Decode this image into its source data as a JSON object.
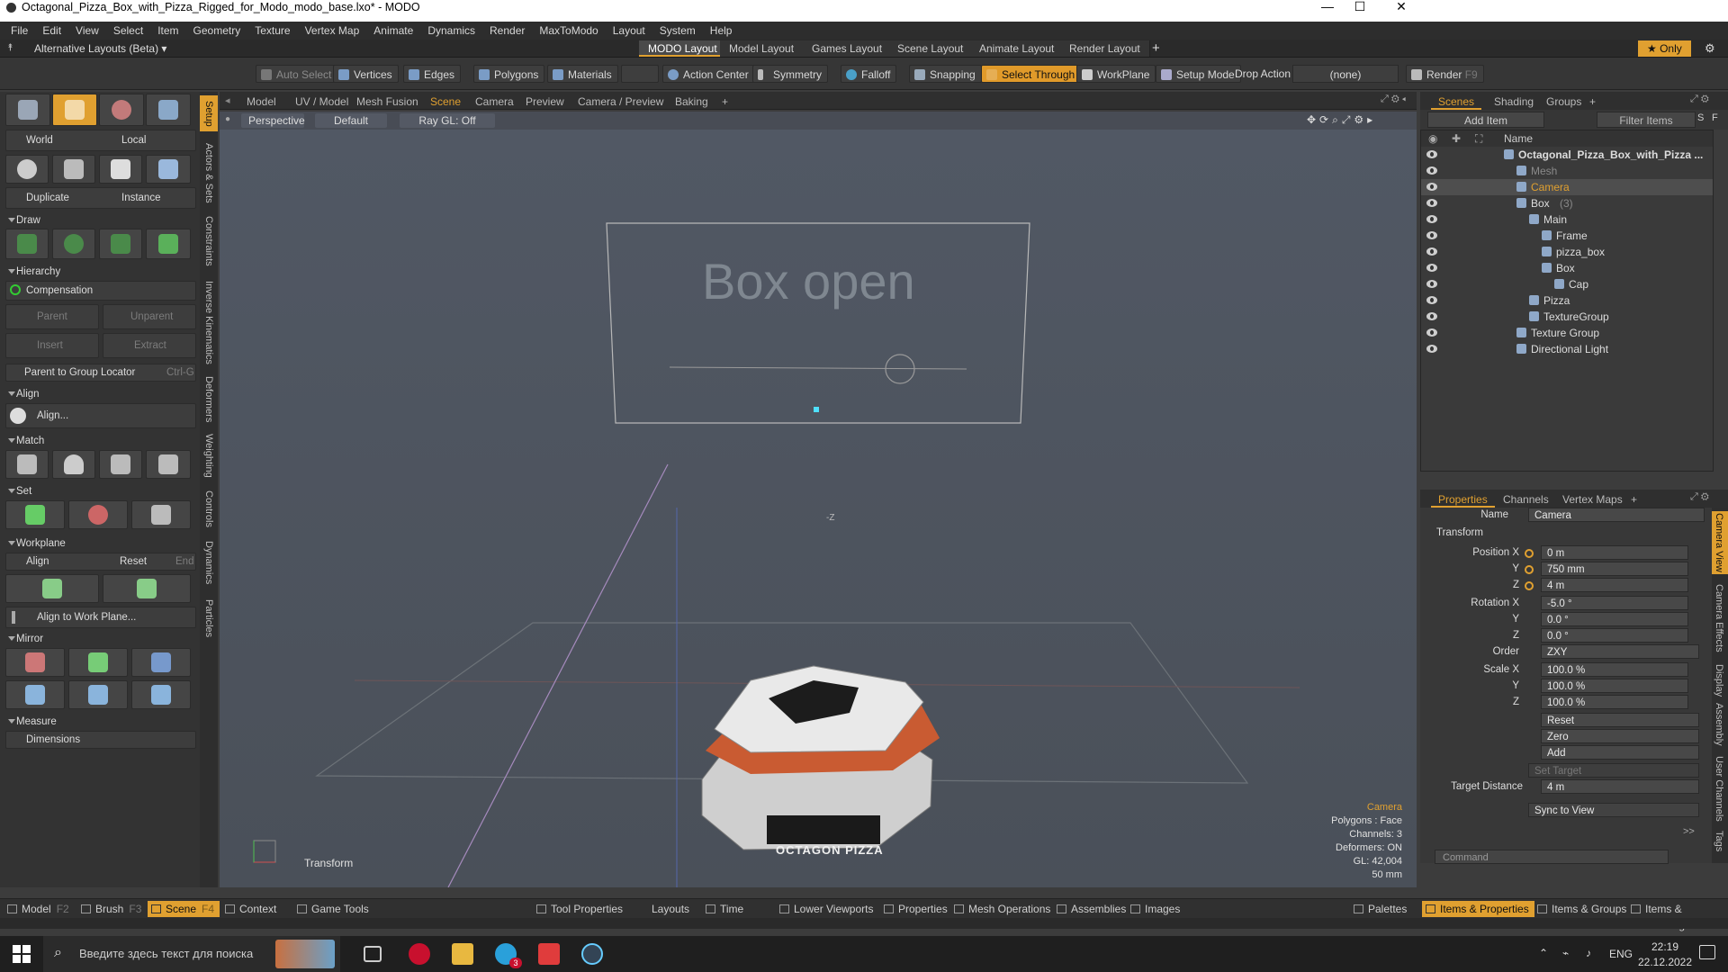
{
  "window": {
    "title": "Octagonal_Pizza_Box_with_Pizza_Rigged_for_Modo_modo_base.lxo* - MODO",
    "minimize": "—",
    "maximize": "☐",
    "close": "✕"
  },
  "menu": [
    "File",
    "Edit",
    "View",
    "Select",
    "Item",
    "Geometry",
    "Texture",
    "Vertex Map",
    "Animate",
    "Dynamics",
    "Render",
    "MaxToModo",
    "Layout",
    "System",
    "Help"
  ],
  "layoutbar": {
    "alt_layouts": "Alternative Layouts (Beta) ▾",
    "tabs": [
      "MODO Layout",
      "Model Layout",
      "Games Layout",
      "Scene Layout",
      "Animate Layout",
      "Render Layout"
    ],
    "plus": "+",
    "only": "★  Only"
  },
  "toolbar": {
    "auto_select": "Auto Select",
    "vertices": "Vertices",
    "edges": "Edges",
    "polygons": "Polygons",
    "materials": "Materials",
    "action_center": "Action Center",
    "symmetry": "Symmetry",
    "falloff": "Falloff",
    "snapping": "Snapping",
    "select_through": "Select Through",
    "workplane": "WorkPlane",
    "setup_mode": "Setup Mode",
    "drop_action": "Drop Action",
    "drop_value": "(none)",
    "render": "Render",
    "render_key": "F9"
  },
  "left": {
    "world": "World",
    "local": "Local",
    "duplicate": "Duplicate",
    "instance": "Instance",
    "draw": "Draw",
    "hierarchy": "Hierarchy",
    "compensation": "Compensation",
    "parent": "Parent",
    "unparent": "Unparent",
    "insert": "Insert",
    "extract": "Extract",
    "parent_group": "Parent to Group Locator",
    "parent_group_key": "Ctrl-G",
    "align": "Align",
    "align_btn": "Align...",
    "match": "Match",
    "set": "Set",
    "workplane": "Workplane",
    "wp_align": "Align",
    "wp_reset": "Reset",
    "wp_end": "End",
    "align_wp": "Align to Work Plane...",
    "mirror": "Mirror",
    "measure": "Measure",
    "dimensions": "Dimensions"
  },
  "vtabs_left": [
    "Setup",
    "Actors & Sets",
    "Constraints",
    "Inverse Kinematics",
    "Deformers",
    "Weighting",
    "Controls",
    "Dynamics",
    "Particles"
  ],
  "viewport": {
    "tabs": [
      "Model",
      "UV / Model",
      "Mesh Fusion",
      "Scene",
      "Camera",
      "Preview",
      "Camera / Preview",
      "Baking"
    ],
    "plus": "+",
    "perspective": "Perspective",
    "default": "Default",
    "raygl": "Ray GL: Off",
    "box_open": "Box open",
    "pizza_label": "OCTAGON PIZZA",
    "axis_z": "-Z",
    "transform": "Transform",
    "info": {
      "camera": "Camera",
      "polygons": "Polygons : Face",
      "channels": "Channels: 3",
      "deformers": "Deformers: ON",
      "gl": "GL: 42,004",
      "mm": "50 mm"
    }
  },
  "scene": {
    "tabs": [
      "Scenes",
      "Shading",
      "Groups"
    ],
    "plus": "+",
    "add_item": "Add Item",
    "filter_items": "Filter Items",
    "s": "S",
    "f": "F",
    "col_name": "Name",
    "items": [
      {
        "label": "Octagonal_Pizza_Box_with_Pizza ...",
        "indent": 0,
        "bold": true
      },
      {
        "label": "Mesh",
        "indent": 1,
        "dim": true
      },
      {
        "label": "Camera",
        "indent": 1,
        "sel": true,
        "orange": true
      },
      {
        "label": "Box",
        "suffix": "(3)",
        "indent": 1
      },
      {
        "label": "Main",
        "indent": 2
      },
      {
        "label": "Frame",
        "indent": 3
      },
      {
        "label": "pizza_box",
        "indent": 3
      },
      {
        "label": "Box",
        "indent": 3
      },
      {
        "label": "Cap",
        "indent": 4
      },
      {
        "label": "Pizza",
        "indent": 2
      },
      {
        "label": "TextureGroup",
        "indent": 2
      },
      {
        "label": "Texture Group",
        "indent": 1
      },
      {
        "label": "Directional Light",
        "indent": 1
      }
    ]
  },
  "properties": {
    "tabs": [
      "Properties",
      "Channels",
      "Vertex Maps"
    ],
    "plus": "+",
    "name_label": "Name",
    "name_value": "Camera",
    "transform": "Transform",
    "pos_x_label": "Position X",
    "pos_x": "0 m",
    "y_label": "Y",
    "pos_y": "750 mm",
    "z_label": "Z",
    "pos_z": "4 m",
    "rot_x_label": "Rotation X",
    "rot_x": "-5.0 °",
    "rot_y": "0.0 °",
    "rot_z": "0.0 °",
    "order_label": "Order",
    "order": "ZXY",
    "scale_x_label": "Scale X",
    "scale_x": "100.0 %",
    "scale_y": "100.0 %",
    "scale_z": "100.0 %",
    "reset": "Reset",
    "zero": "Zero",
    "add": "Add",
    "set_target": "Set Target",
    "target_distance_label": "Target Distance",
    "target_distance": "4 m",
    "sync": "Sync to View",
    "more": ">>",
    "command_placeholder": "Command"
  },
  "vtabs_right": [
    "Camera View",
    "Camera Effects",
    "Display",
    "Assembly",
    "User Channels",
    "Tags"
  ],
  "bottom": {
    "model": "Model",
    "model_key": "F2",
    "brush": "Brush",
    "brush_key": "F3",
    "scene": "Scene",
    "scene_key": "F4",
    "context": "Context",
    "game_tools": "Game Tools",
    "tool_properties": "Tool Properties",
    "layouts": "Layouts",
    "time": "Time",
    "lower_viewports": "Lower Viewports",
    "properties": "Properties",
    "mesh_operations": "Mesh Operations",
    "assemblies": "Assemblies",
    "images": "Images",
    "palettes": "Palettes",
    "items_props": "Items & Properties",
    "items_groups": "Items & Groups",
    "items_shading": "Items & Shading"
  },
  "taskbar": {
    "search_placeholder": "Введите здесь текст для поиска",
    "lang": "ENG",
    "time": "22:19",
    "date": "22.12.2022",
    "notif": "3"
  },
  "colors": {
    "accent": "#e0a030",
    "viewport": "#4f5661"
  }
}
